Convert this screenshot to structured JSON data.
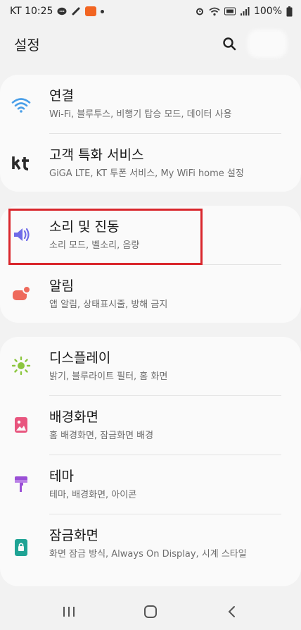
{
  "status_bar": {
    "carrier_time": "KT 10:25",
    "battery": "100%",
    "icons": [
      "chat-icon",
      "link-icon",
      "app-icon",
      "dot-icon",
      "alarm-icon",
      "wifi-icon",
      "lte-icon",
      "signal-icon",
      "battery-icon"
    ]
  },
  "header": {
    "title": "설정",
    "search_icon": "search-icon"
  },
  "settings": {
    "items": [
      {
        "title": "연결",
        "subtitle": "Wi-Fi, 블루투스, 비행기 탑승 모드, 데이터 사용",
        "icon": "wifi-icon",
        "color": "#4a9fe8"
      },
      {
        "title": "고객 특화 서비스",
        "subtitle": "GiGA LTE, KT 투폰 서비스, My WiFi home 설정",
        "icon": "kt-logo-icon",
        "color": "#2b2b2b"
      },
      {
        "title": "소리 및 진동",
        "subtitle": "소리 모드, 벨소리, 음량",
        "icon": "sound-icon",
        "color": "#6f6be8"
      },
      {
        "title": "알림",
        "subtitle": "앱 알림, 상태표시줄, 방해 금지",
        "icon": "notification-icon",
        "color": "#ee6a5c"
      },
      {
        "title": "디스플레이",
        "subtitle": "밝기, 블루라이트 필터, 홈 화면",
        "icon": "brightness-icon",
        "color": "#8cc63f"
      },
      {
        "title": "배경화면",
        "subtitle": "홈 배경화면, 잠금화면 배경",
        "icon": "wallpaper-icon",
        "color": "#e8557e"
      },
      {
        "title": "테마",
        "subtitle": "테마, 배경화면, 아이콘",
        "icon": "theme-icon",
        "color": "#9a4fd6"
      },
      {
        "title": "잠금화면",
        "subtitle": "화면 잠금 방식, Always On Display, 시계 스타일",
        "icon": "lock-screen-icon",
        "color": "#1fa394"
      }
    ]
  },
  "highlight_color": "#d9262c",
  "nav_bar": {
    "icons": [
      "recents-icon",
      "home-icon",
      "back-icon"
    ]
  }
}
